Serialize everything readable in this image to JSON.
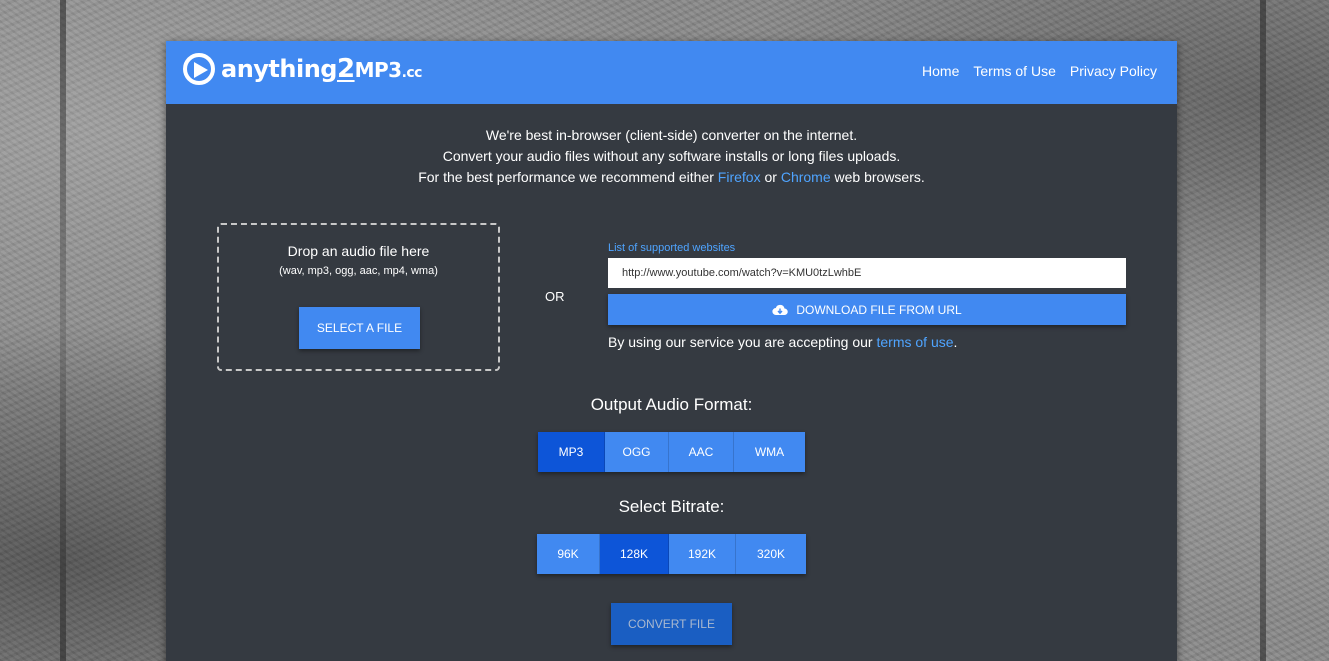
{
  "header": {
    "logo": {
      "part1": "anything",
      "part2": "2",
      "part3": "MP3",
      "part4": ".cc"
    },
    "nav": [
      "Home",
      "Terms of Use",
      "Privacy Policy"
    ]
  },
  "intro": {
    "line1": "We're best in-browser (client-side) converter on the internet.",
    "line2": "Convert your audio files without any software installs or long files uploads.",
    "line3_start": "For the best performance we recommend either ",
    "firefox": "Firefox",
    "or": " or ",
    "chrome": "Chrome",
    "line3_end": " web browsers."
  },
  "dropzone": {
    "title": "Drop an audio file here",
    "subtitle": "(wav, mp3, ogg, aac, mp4, wma)",
    "button": "SELECT A FILE"
  },
  "or_label": "OR",
  "url": {
    "supported_link": "List of supported websites",
    "value": "http://www.youtube.com/watch?v=KMU0tzLwhbE",
    "download_button": "DOWNLOAD FILE FROM URL",
    "accept_start": "By using our service you are accepting our ",
    "terms_link": "terms of use",
    "accept_end": "."
  },
  "output_format": {
    "title": "Output Audio Format:",
    "options": [
      "MP3",
      "OGG",
      "AAC",
      "WMA"
    ],
    "selected": "MP3"
  },
  "bitrate": {
    "title": "Select Bitrate:",
    "options": [
      "96K",
      "128K",
      "192K",
      "320K"
    ],
    "selected": "128K"
  },
  "convert_button": "CONVERT FILE",
  "colors": {
    "brand_blue": "#4189f1",
    "active_blue": "#0d55d8",
    "panel_bg": "#353a41",
    "link": "#4fa4ff"
  }
}
